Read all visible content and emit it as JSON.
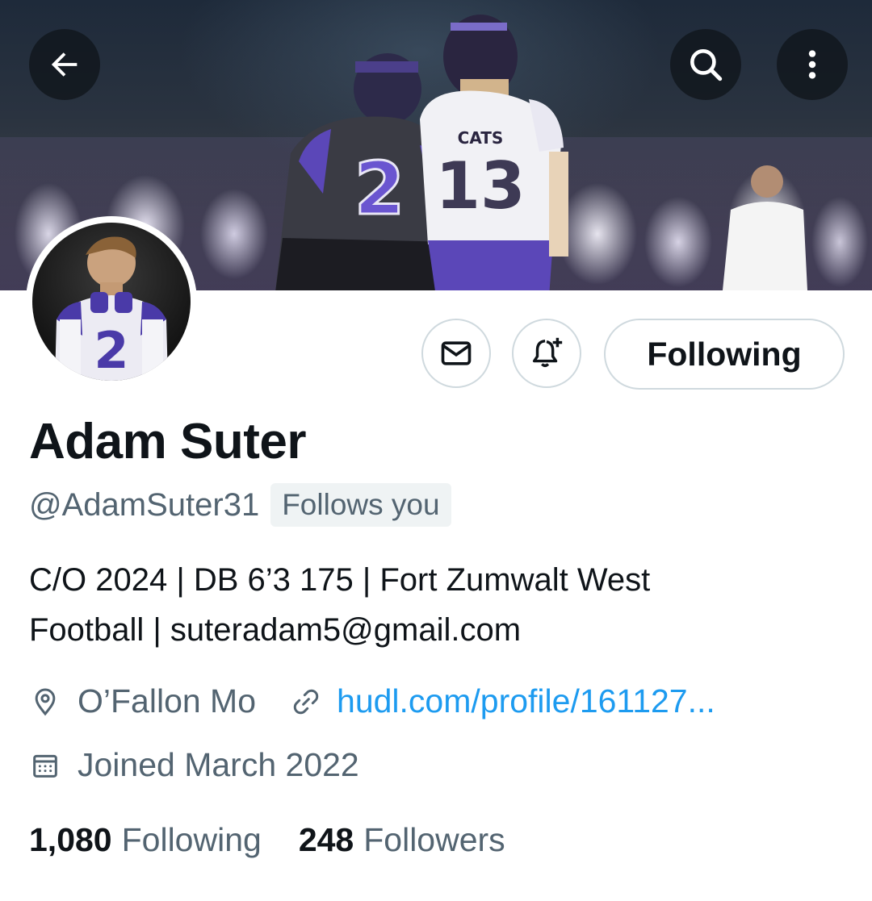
{
  "header": {
    "back_icon": "arrow-left-icon",
    "search_icon": "search-icon",
    "more_icon": "more-vertical-icon"
  },
  "banner": {
    "jersey_dark": "2",
    "jersey_white": "13",
    "jersey_text": "CATS"
  },
  "avatar": {
    "jersey_number": "2"
  },
  "actions": {
    "message_icon": "envelope-icon",
    "notify_icon": "bell-plus-icon",
    "follow_label": "Following"
  },
  "profile": {
    "name": "Adam Suter",
    "handle": "@AdamSuter31",
    "follows_you": "Follows you",
    "bio_line1": "C/O 2024 | DB 6’3 175 | Fort Zumwalt West",
    "bio_line2": "Football | suteradam5@gmail.com",
    "location": "O’Fallon Mo",
    "website": "hudl.com/profile/161127...",
    "joined": "Joined March 2022"
  },
  "stats": {
    "following_count": "1,080",
    "following_label": "Following",
    "followers_count": "248",
    "followers_label": "Followers"
  },
  "colors": {
    "text_primary": "#0f1419",
    "text_secondary": "#536471",
    "link": "#1d9bf0",
    "border": "#cfd9de"
  }
}
